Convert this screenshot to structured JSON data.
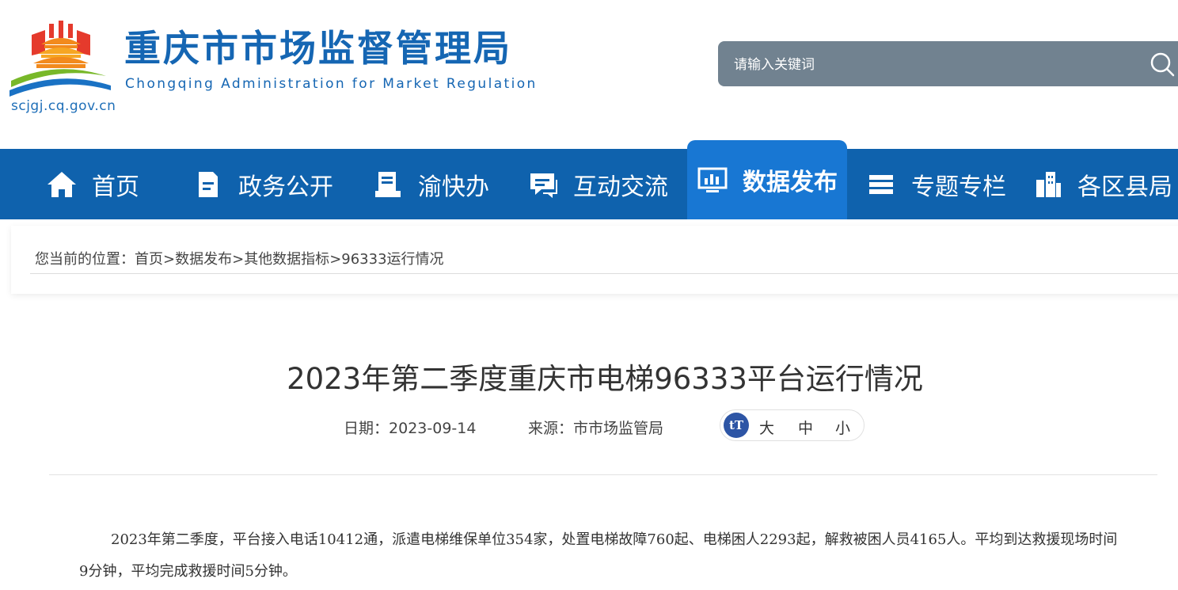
{
  "header": {
    "title": "重庆市市场监督管理局",
    "subtitle": "Chongqing Administration for Market Regulation",
    "domain": "scjgj.cq.gov.cn",
    "search_placeholder": "请输入关键词",
    "brand_color": "#1566b3"
  },
  "nav": {
    "items": [
      {
        "label": "首页",
        "icon": "home-icon"
      },
      {
        "label": "政务公开",
        "icon": "document-icon"
      },
      {
        "label": "渝快办",
        "icon": "handbook-icon"
      },
      {
        "label": "互动交流",
        "icon": "chat-icon"
      },
      {
        "label": "数据发布",
        "icon": "chart-monitor-icon",
        "active": true
      },
      {
        "label": "专题专栏",
        "icon": "stack-icon"
      },
      {
        "label": "各区县局",
        "icon": "buildings-icon"
      }
    ],
    "bg_color": "#0f62ad",
    "active_color": "#1877d3"
  },
  "breadcrumb": {
    "prefix": "您当前的位置：",
    "items": [
      "首页",
      "数据发布",
      "其他数据指标",
      "96333运行情况"
    ],
    "separator": ">"
  },
  "article": {
    "title": "2023年第二季度重庆市电梯96333平台运行情况",
    "date_label": "日期：",
    "date": "2023-09-14",
    "source_label": "来源：",
    "source": "市市场监管局",
    "font_size_icon_text": "tT",
    "font_sizes": [
      "大",
      "中",
      "小"
    ],
    "body": "2023年第二季度，平台接入电话10412通，派遣电梯维保单位354家，处置电梯故障760起、电梯困人2293起，解救被困人员4165人。平均到达救援现场时间9分钟，平均完成救援时间5分钟。"
  }
}
